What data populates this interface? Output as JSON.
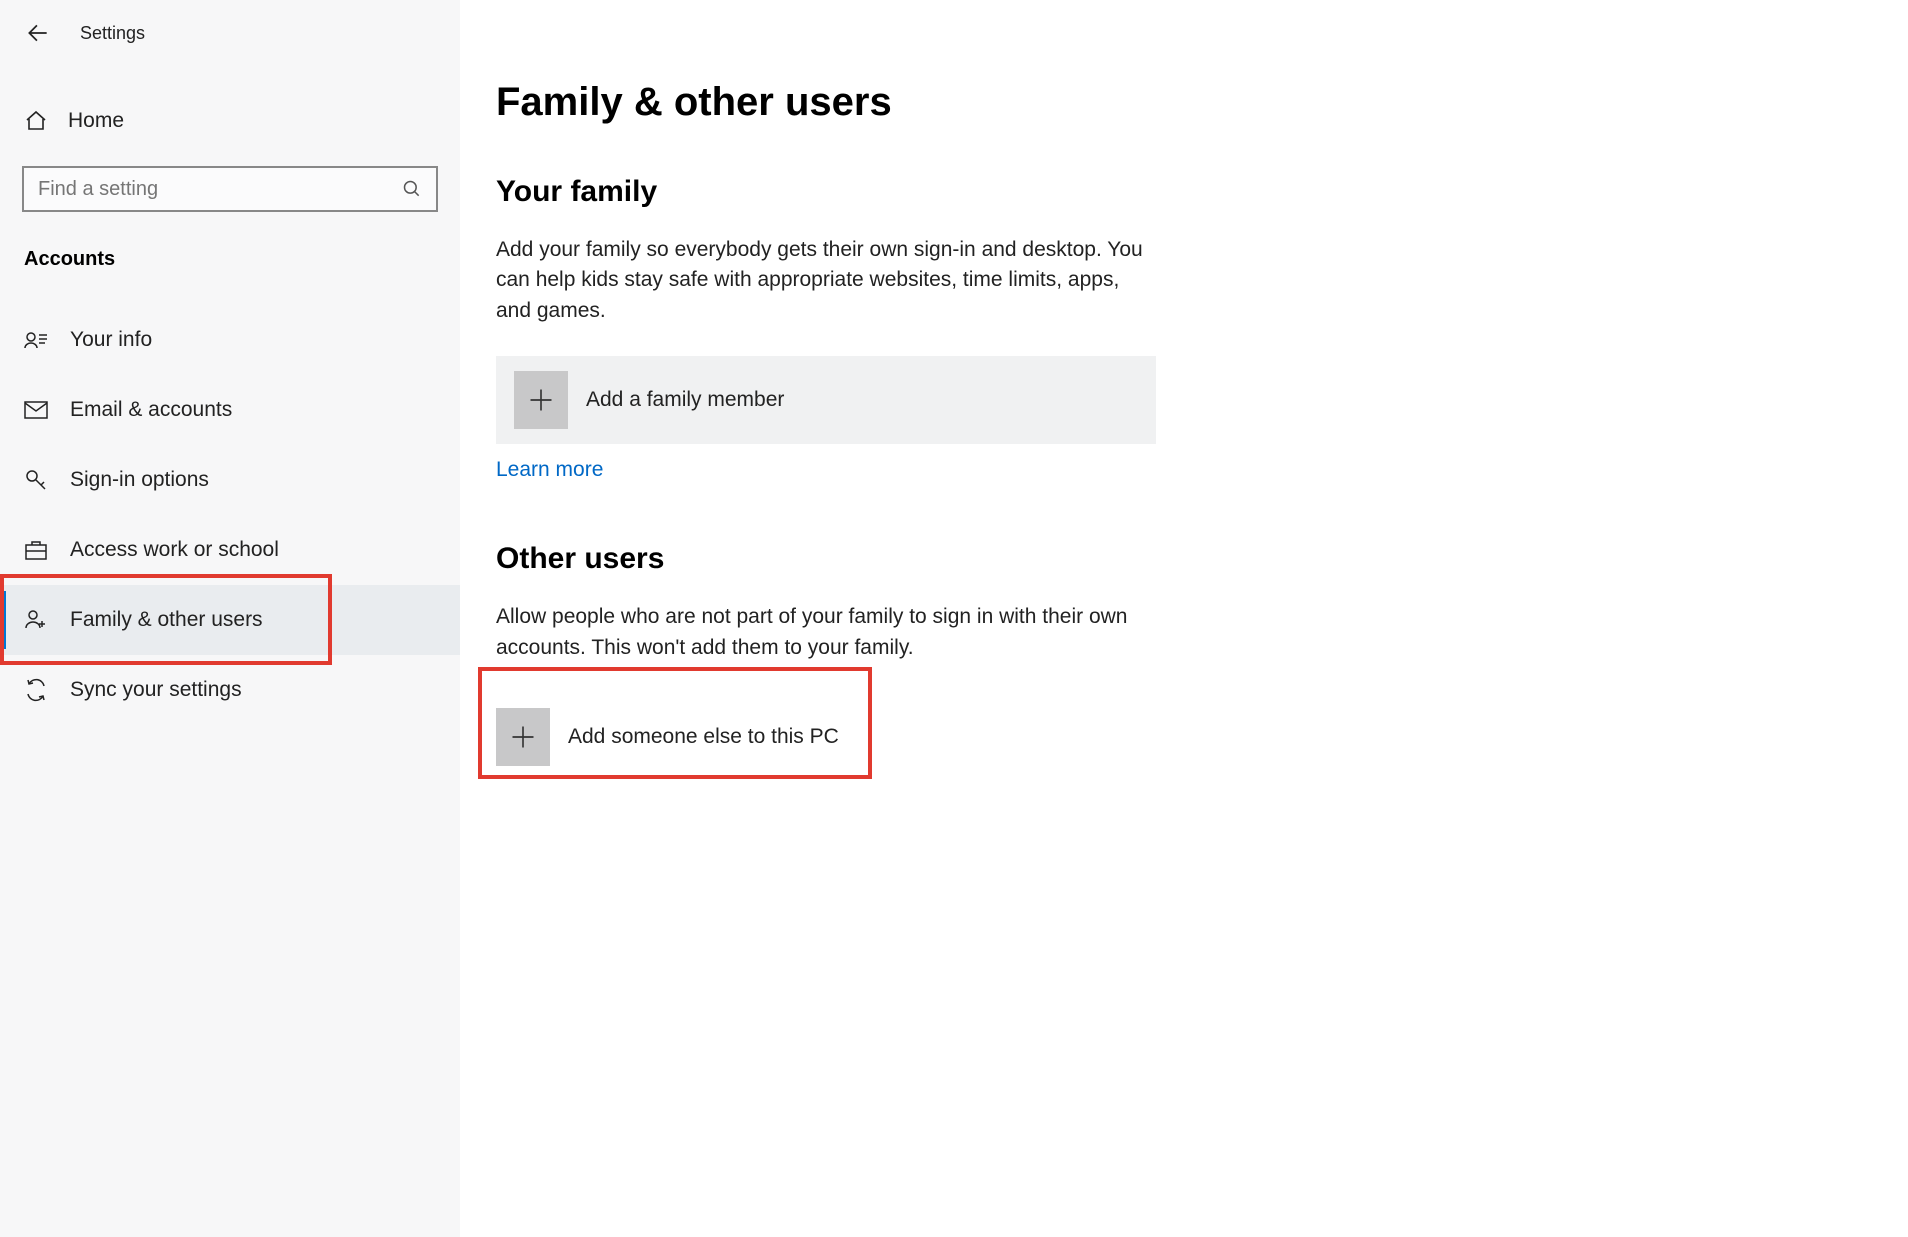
{
  "header": {
    "title": "Settings"
  },
  "sidebar": {
    "home_label": "Home",
    "search_placeholder": "Find a setting",
    "category": "Accounts",
    "items": [
      {
        "label": "Your info"
      },
      {
        "label": "Email & accounts"
      },
      {
        "label": "Sign-in options"
      },
      {
        "label": "Access work or school"
      },
      {
        "label": "Family & other users"
      },
      {
        "label": "Sync your settings"
      }
    ]
  },
  "page": {
    "title": "Family & other users",
    "family": {
      "heading": "Your family",
      "description": "Add your family so everybody gets their own sign-in and desktop. You can help kids stay safe with appropriate websites, time limits, apps, and games.",
      "add_label": "Add a family member",
      "learn_more": "Learn more"
    },
    "other": {
      "heading": "Other users",
      "description": "Allow people who are not part of your family to sign in with their own accounts. This won't add them to your family.",
      "add_label": "Add someone else to this PC"
    }
  }
}
